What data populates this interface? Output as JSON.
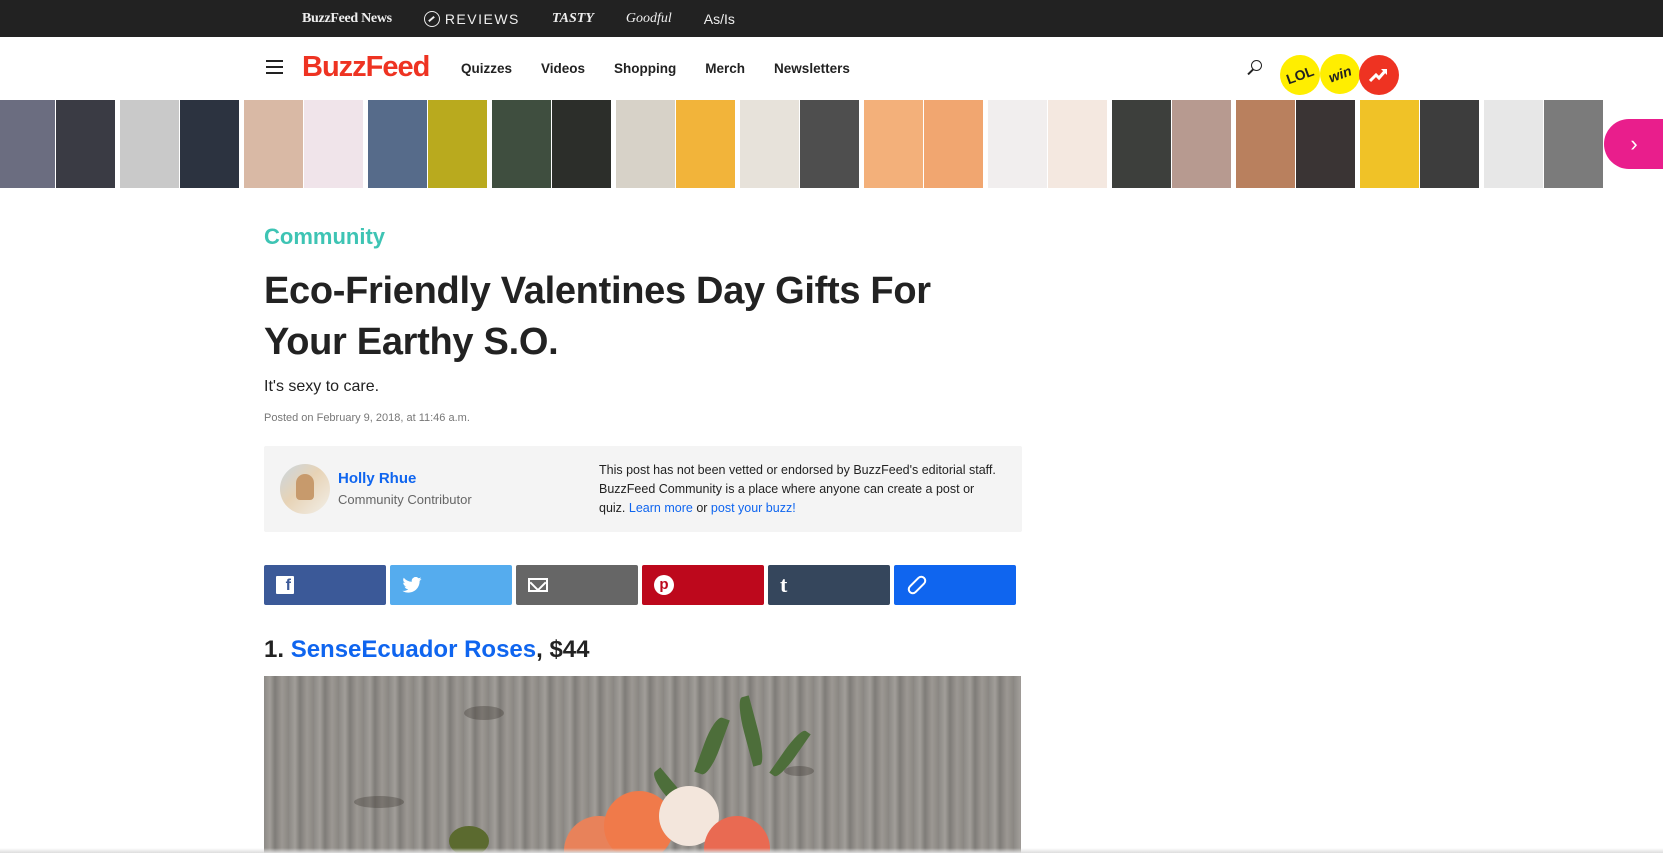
{
  "topbar": {
    "links": [
      "BuzzFeed News",
      "REVIEWS",
      "TASTY",
      "Goodful",
      "As/Is"
    ]
  },
  "nav": {
    "logo": "BuzzFeed",
    "links": [
      "Quizzes",
      "Videos",
      "Shopping",
      "Merch",
      "Newsletters"
    ],
    "badges": [
      "LOL",
      "win"
    ],
    "icons": [
      "menu-icon",
      "search-icon",
      "trending-icon"
    ]
  },
  "strip": {
    "next_label": "›",
    "thumb_colors": [
      [
        "#6b6d80",
        "#3a3b44"
      ],
      [
        "#c9c9c9",
        "#2c3340"
      ],
      [
        "#d9b9a5",
        "#f0e4ea"
      ],
      [
        "#566b8a",
        "#b9aa1e"
      ],
      [
        "#3f4e3f",
        "#2c2e2a"
      ],
      [
        "#d7d2c8",
        "#f2b43a"
      ],
      [
        "#e7e2da",
        "#4e4e4e"
      ],
      [
        "#f3b07a",
        "#f1a670"
      ],
      [
        "#f1eeee",
        "#f4e8e0"
      ],
      [
        "#3d3f3c",
        "#b79a90"
      ],
      [
        "#b9805e",
        "#3a3434"
      ],
      [
        "#f0c227",
        "#3d3d3d"
      ],
      [
        "#e7e7e7",
        "#7b7b7b"
      ]
    ]
  },
  "article": {
    "category": "Community",
    "title": "Eco-Friendly Valentines Day Gifts For Your Earthy S.O.",
    "dek": "It's sexy to care.",
    "posted": "Posted on February 9, 2018, at 11:46 a.m.",
    "author": {
      "name": "Holly Rhue",
      "role": "Community Contributor"
    },
    "disclaimer": {
      "text": "This post has not been vetted or endorsed by BuzzFeed's editorial staff. BuzzFeed Community is a place where anyone can create a post or quiz.",
      "learn_more": "Learn more",
      "or": "or",
      "post_link": "post your buzz!"
    },
    "share": [
      "facebook-icon",
      "twitter-icon",
      "email-icon",
      "pinterest-icon",
      "tumblr-icon",
      "link-icon"
    ],
    "item1": {
      "number": "1.",
      "link": "SenseEcuador Roses",
      "price": ", $44"
    }
  },
  "colors": {
    "accent": "#0f65ef",
    "brand": "#ee3322",
    "community": "#3ec4b4",
    "facebook": "#3b5998",
    "twitter": "#55acee",
    "pinterest": "#bd081c",
    "tumblr": "#35465c"
  }
}
